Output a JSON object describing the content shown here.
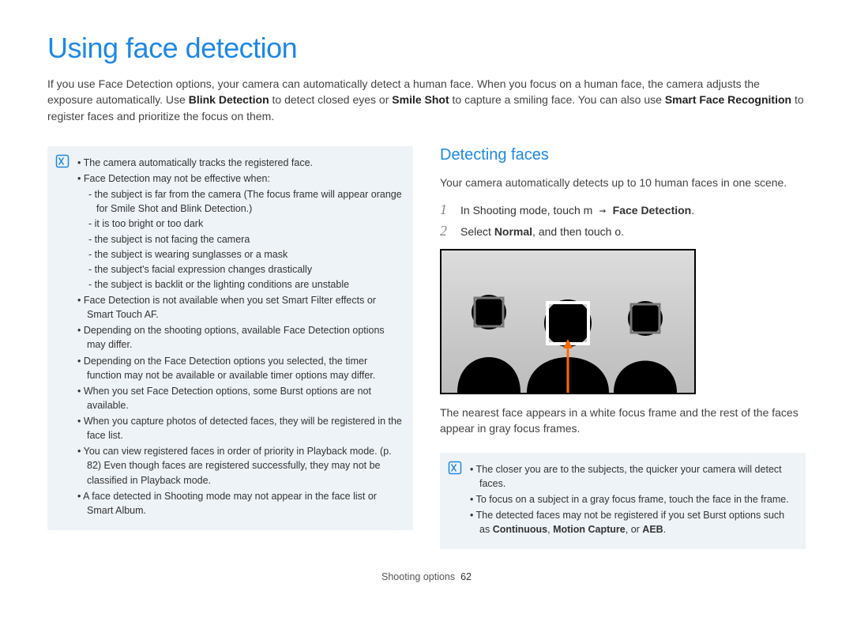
{
  "title": "Using face detection",
  "intro": {
    "t1": "If you use Face Detection options, your camera can automatically detect a human face. When you focus on a human face, the camera adjusts the exposure automatically. Use ",
    "b1": "Blink Detection",
    "t2": " to detect closed eyes or ",
    "b2": "Smile Shot",
    "t3": " to capture a smiling face. You can also use ",
    "b3": "Smart Face Recognition",
    "t4": " to register faces and prioritize the focus on them."
  },
  "leftbox": {
    "b0": "The camera automatically tracks the registered face.",
    "b1": "Face Detection may not be effective when:",
    "s1": "the subject is far from the camera (The focus frame will appear orange for Smile Shot and Blink Detection.)",
    "s2": "it is too bright or too dark",
    "s3": "the subject is not facing the camera",
    "s4": "the subject is wearing sunglasses or a mask",
    "s5": "the subject's facial expression changes drastically",
    "s6": "the subject is backlit or the lighting conditions are unstable",
    "b2": "Face Detection is not available when you set Smart Filter effects or Smart Touch AF.",
    "b3": "Depending on the shooting options, available Face Detection options may differ.",
    "b4": "Depending on the Face Detection options you selected, the timer function may not be available or available timer options may differ.",
    "b5": "When you set Face Detection options, some Burst options are not available.",
    "b6": "When you capture photos of detected faces, they will be registered in the face list.",
    "b7": "You can view registered faces in order of priority in Playback mode. (p. 82) Even though faces are registered successfully, they may not be classified in Playback mode.",
    "b8": "A face detected in Shooting mode may not appear in the face list or Smart Album."
  },
  "right": {
    "h2": "Detecting faces",
    "p1": "Your camera automatically detects up to 10 human faces in one scene.",
    "step1_a": "In Shooting mode, touch ",
    "step1_m": "m",
    "step1_arrow": " → ",
    "step1_b": "Face Detection",
    "step1_dot": ".",
    "step2_a": "Select ",
    "step2_b": "Normal",
    "step2_c": ", and then touch ",
    "step2_o": "o",
    "step2_dot": ".",
    "caption": "The nearest face appears in a white focus frame and the rest of the faces appear in gray focus frames.",
    "box2": {
      "l1": "The closer you are to the subjects, the quicker your camera will detect faces.",
      "l2": "To focus on a subject in a gray focus frame, touch the face in the frame.",
      "l3a": "The detected faces may not be registered if you set Burst options such as ",
      "l3b1": "Continuous",
      "l3b2": "Motion Capture",
      "l3or": ", or ",
      "l3b3": "AEB",
      "l3dot": "."
    }
  },
  "footer": {
    "section": "Shooting options",
    "page": "62"
  }
}
